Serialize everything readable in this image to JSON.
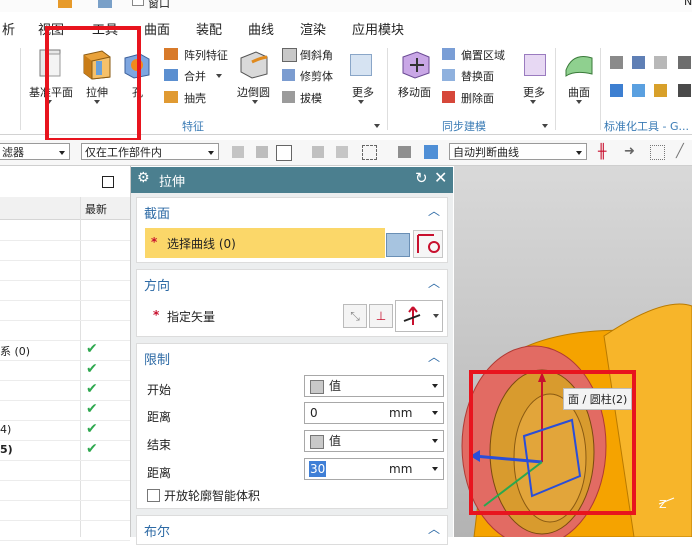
{
  "titlebar": {
    "window_label": "窗口",
    "right_char": "N"
  },
  "menu": {
    "items": [
      "析",
      "视图",
      "工具",
      "曲面",
      "装配",
      "曲线",
      "渲染",
      "应用模块"
    ]
  },
  "ribbon": {
    "datum_plane": "基准平面",
    "extrude": "拉伸",
    "hole": "孔",
    "pattern_feature": "阵列特征",
    "unite": "合并",
    "shell": "抽壳",
    "edge_blend": "边倒圆",
    "chamfer": "倒斜角",
    "trim_body": "修剪体",
    "draft": "拔模",
    "more_1": "更多",
    "move_face": "移动面",
    "offset_region": "偏置区域",
    "replace_face": "替换面",
    "delete_face": "删除面",
    "more_2": "更多",
    "surface": "曲面",
    "group_feature": "特征",
    "group_sync": "同步建模",
    "group_std": "标准化工具 - G..."
  },
  "toolbar": {
    "filter_label": "滤器",
    "scope": "仅在工作部件内",
    "curve_rule": "自动判断曲线"
  },
  "navigator": {
    "header_right": "最新",
    "rows": [
      {
        "text": "",
        "check": false
      },
      {
        "text": "",
        "check": false
      },
      {
        "text": "",
        "check": false
      },
      {
        "text": "",
        "check": false
      },
      {
        "text": "",
        "check": false
      },
      {
        "text": "",
        "check": false
      },
      {
        "text": "系 (0)",
        "check": true
      },
      {
        "text": "",
        "check": true
      },
      {
        "text": "",
        "check": true
      },
      {
        "text": "",
        "check": true
      },
      {
        "text": "4)",
        "check": true
      },
      {
        "text": "5)",
        "check": true
      },
      {
        "text": "",
        "check": false
      },
      {
        "text": "",
        "check": false
      },
      {
        "text": "",
        "check": false
      },
      {
        "text": "",
        "check": false
      }
    ]
  },
  "dialog": {
    "title": "拉伸",
    "section_section": "截面",
    "select_curve": "选择曲线 (0)",
    "section_direction": "方向",
    "specify_vector": "指定矢量",
    "section_limits": "限制",
    "start_label": "开始",
    "start_mode": "值",
    "start_dist_label": "距离",
    "start_dist": "0",
    "end_label": "结束",
    "end_mode": "值",
    "end_dist_label": "距离",
    "end_dist": "30",
    "unit": "mm",
    "open_profile": "开放轮廓智能体积",
    "section_boolean": "布尔"
  },
  "viewport": {
    "tooltip": "面 / 圆柱(2)",
    "axis_z": "Z"
  },
  "colors": {
    "dialog_header": "#4b7f8f",
    "highlight_row": "#fbd769",
    "accent_blue": "#2d6aa5",
    "red_box": "#e8141e",
    "part_orange": "#f5a300"
  }
}
